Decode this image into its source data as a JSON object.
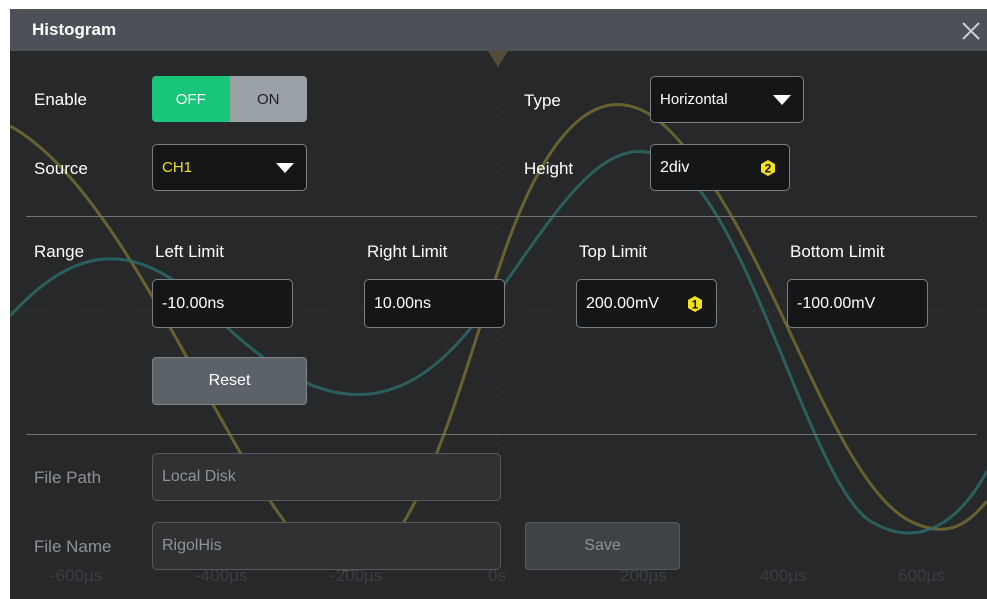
{
  "dialog": {
    "title": "Histogram"
  },
  "enable": {
    "label": "Enable",
    "off_label": "OFF",
    "on_label": "ON",
    "selected": "OFF"
  },
  "type": {
    "label": "Type",
    "value": "Horizontal"
  },
  "source": {
    "label": "Source",
    "value": "CH1"
  },
  "height": {
    "label": "Height",
    "value": "2div",
    "badge": "2"
  },
  "range": {
    "label": "Range",
    "left_limit": {
      "label": "Left Limit",
      "value": "-10.00ns"
    },
    "right_limit": {
      "label": "Right Limit",
      "value": "10.00ns"
    },
    "top_limit": {
      "label": "Top Limit",
      "value": "200.00mV",
      "badge": "1"
    },
    "bottom_limit": {
      "label": "Bottom Limit",
      "value": "-100.00mV"
    },
    "reset_label": "Reset"
  },
  "file": {
    "path_label": "File Path",
    "path_value": "Local Disk",
    "name_label": "File Name",
    "name_value": "RigolHis",
    "save_label": "Save"
  },
  "background_axis": {
    "labels": [
      "-600μs",
      "-400μs",
      "-200μs",
      "0s",
      "200μs",
      "400μs",
      "600μs"
    ]
  },
  "colors": {
    "dialog_bg": "#272829",
    "titlebar_bg": "#4b5157",
    "toggle_active": "#19c57a",
    "badge": "#f5e21b",
    "ch1_trace": "#9a8f3a",
    "ch2_trace": "#3e8a87"
  }
}
